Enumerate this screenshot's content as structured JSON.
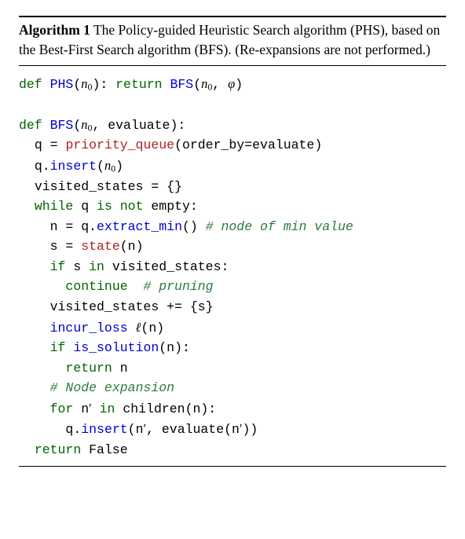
{
  "header": {
    "algo_label": "Algorithm 1",
    "title_rest": " The Policy-guided Heuristic Search algorithm (PHS), based on the Best-First Search algorithm (BFS). (Re-expansions are not performed.)"
  },
  "tok": {
    "def": "def",
    "return": "return",
    "while": "while",
    "is": "is",
    "not": "not",
    "if": "if",
    "in": "in",
    "continue": "continue",
    "for": "for"
  },
  "fn": {
    "PHS": "PHS",
    "BFS": "BFS",
    "insert": "insert",
    "extract_min": "extract_min",
    "incur_loss": "incur_loss",
    "is_solution": "is_solution"
  },
  "cls": {
    "priority_queue": "priority_queue",
    "state": "state"
  },
  "sym": {
    "n0": "n",
    "n0_sub": "0",
    "phi": "φ",
    "ell": "ℓ",
    "n": "n",
    "nprime": "n",
    "prime": "′",
    "s": "s"
  },
  "txt": {
    "evaluate": "evaluate",
    "q": "q",
    "order_by": "order_by",
    "visited_states": "visited_states",
    "empty": "empty",
    "children": "children",
    "False": "False",
    "empty_set": "{}",
    "set_s": "{s}"
  },
  "cmt": {
    "min_value": "# node of min value",
    "pruning": "# pruning",
    "expansion": "# Node expansion"
  }
}
